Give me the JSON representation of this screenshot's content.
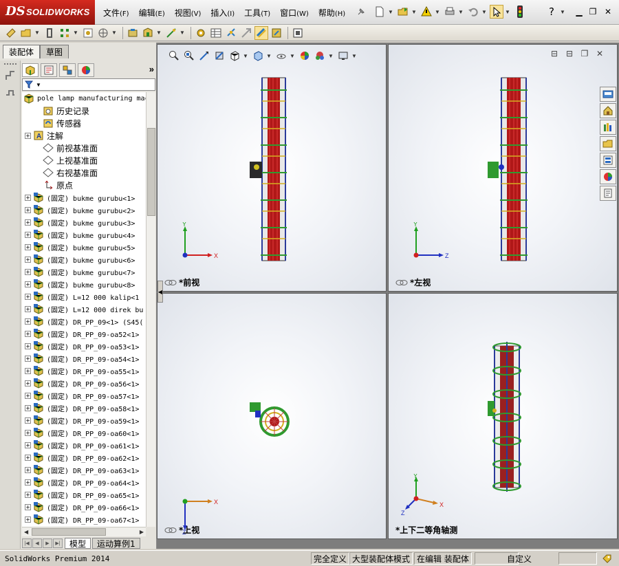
{
  "app": {
    "logo_ds": "DS",
    "logo_name": "SOLIDWORKS"
  },
  "menus": [
    {
      "label": "文件",
      "key": "(F)"
    },
    {
      "label": "编辑",
      "key": "(E)"
    },
    {
      "label": "视图",
      "key": "(V)"
    },
    {
      "label": "插入",
      "key": "(I)"
    },
    {
      "label": "工具",
      "key": "(T)"
    },
    {
      "label": "窗口",
      "key": "(W)"
    },
    {
      "label": "帮助",
      "key": "(H)"
    }
  ],
  "left_tabs": [
    "装配体",
    "草图"
  ],
  "tree": {
    "root": "pole lamp manufacturing mac",
    "system_items": [
      "历史记录",
      "传感器",
      "注解",
      "前视基准面",
      "上视基准面",
      "右视基准面",
      "原点"
    ],
    "components": [
      "(固定) bukme gurubu<1>",
      "(固定) bukme gurubu<2>",
      "(固定) bukme gurubu<3>",
      "(固定) bukme gurubu<4>",
      "(固定) bukme gurubu<5>",
      "(固定) bukme gurubu<6>",
      "(固定) bukme gurubu<7>",
      "(固定) bukme gurubu<8>",
      "(固定) L=12 000 kalip<1",
      "(固定) L=12 000 direk bu",
      "(固定) DR_PP_09<1> (S45(",
      "(固定) DR_PP_09-oa52<1>",
      "(固定) DR_PP_09-oa53<1>",
      "(固定) DR_PP_09-oa54<1>",
      "(固定) DR_PP_09-oa55<1>",
      "(固定) DR_PP_09-oa56<1>",
      "(固定) DR_PP_09-oa57<1>",
      "(固定) DR_PP_09-oa58<1>",
      "(固定) DR_PP_09-oa59<1>",
      "(固定) DR_PP_09-oa60<1>",
      "(固定) DR_PP_09-oa61<1>",
      "(固定) DR_PP_09-oa62<1>",
      "(固定) DR_PP_09-oa63<1>",
      "(固定) DR_PP_09-oa64<1>",
      "(固定) DR_PP_09-oa65<1>",
      "(固定) DR_PP_09-oa66<1>",
      "(固定) DR_PP_09-oa67<1>"
    ]
  },
  "bottom_tabs": [
    "模型",
    "运动算例1"
  ],
  "viewports": {
    "front": "*前视",
    "left": "*左视",
    "top": "*上视",
    "iso": "*上下二等角轴测"
  },
  "axes": {
    "x": "X",
    "y": "Y",
    "z": "Z"
  },
  "status": {
    "app": "SolidWorks Premium 2014",
    "defined": "完全定义",
    "mode": "大型装配体模式",
    "editing": "在编辑 装配体",
    "units": "自定义"
  },
  "colors": {
    "accent_red": "#c8271c",
    "pole_red": "#b01818",
    "ring_green": "#2f9a2f",
    "frame_blue": "#2a3a9a",
    "axis_red": "#d02020",
    "axis_green": "#20a020",
    "axis_blue": "#2030c0"
  }
}
